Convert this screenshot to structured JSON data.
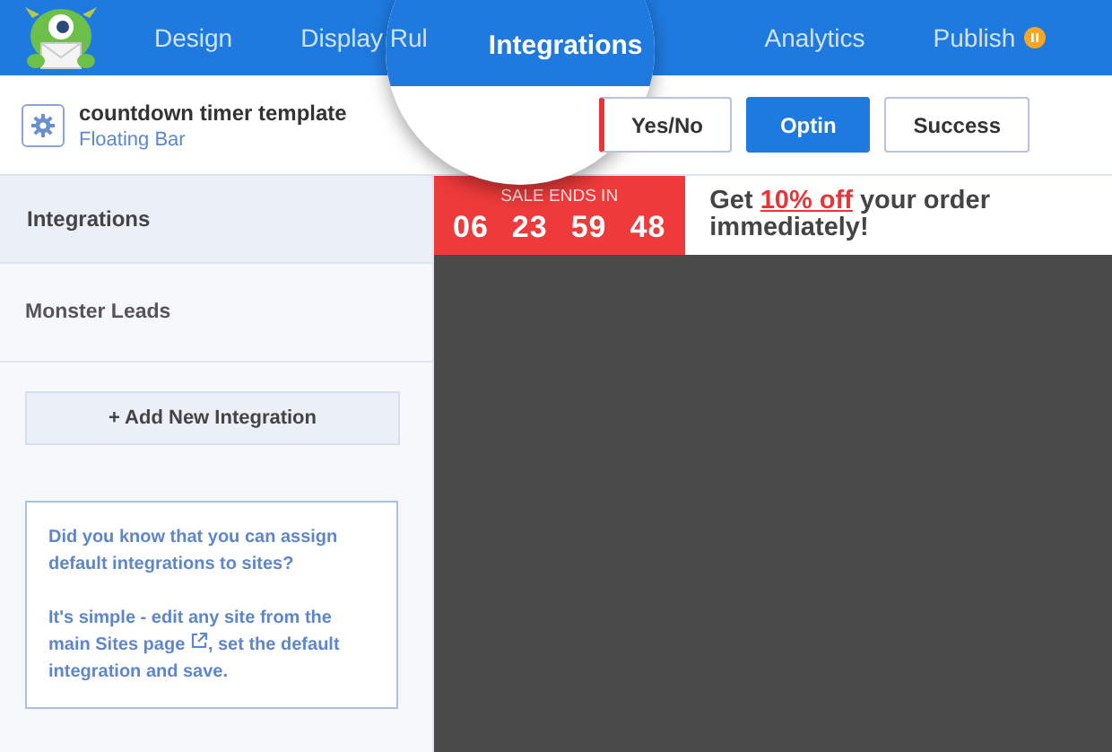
{
  "nav": {
    "tabs": [
      {
        "label": "Design",
        "selected": false
      },
      {
        "label": "Display Rul",
        "selected": false
      },
      {
        "label": "Integrations",
        "selected": true
      },
      {
        "label": "Analytics",
        "selected": false
      },
      {
        "label": "Publish",
        "selected": false,
        "badge": true
      }
    ]
  },
  "header": {
    "title": "countdown timer template",
    "subtitle": "Floating Bar",
    "views": [
      {
        "label": "Yes/No",
        "selected": false
      },
      {
        "label": "Optin",
        "selected": true
      },
      {
        "label": "Success",
        "selected": false
      }
    ]
  },
  "sidebar": {
    "heading": "Integrations",
    "items": [
      "Monster Leads"
    ],
    "add_button": "+ Add New Integration",
    "tip": {
      "paragraph_1": "Did you know that you can assign default integrations to sites?",
      "paragraph_2_before": "It's simple - edit any site from the main",
      "link": "Sites page",
      "paragraph_2_after": ", set the default integration and save."
    }
  },
  "preview": {
    "countdown_label": "SALE ENDS IN",
    "countdown": [
      "06",
      "23",
      "59",
      "48"
    ],
    "message_before": "Get",
    "message_highlight": "10% off",
    "message_after": "your order immediately!"
  }
}
